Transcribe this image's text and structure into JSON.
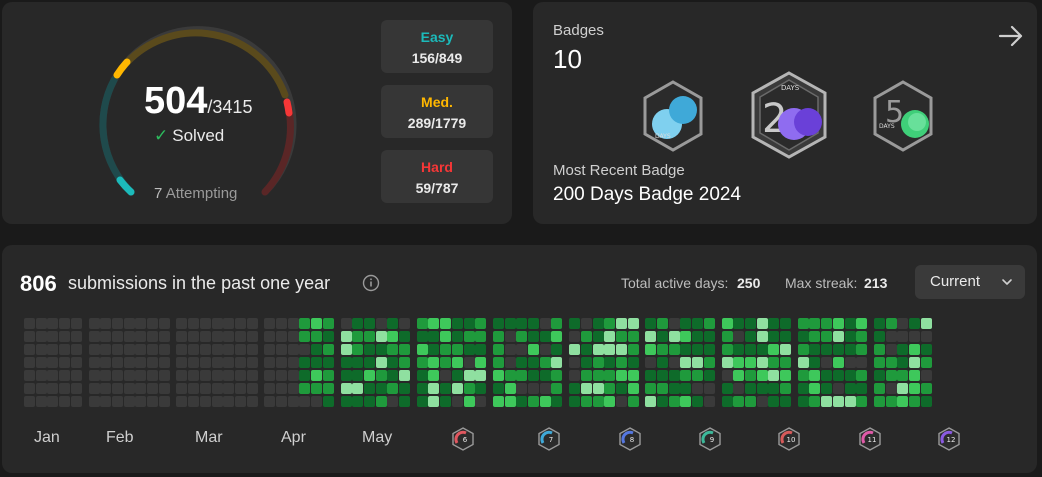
{
  "solved": {
    "count": "504",
    "total": "/3415",
    "label": "Solved",
    "attempting_count": "7",
    "attempting_label": "Attempting",
    "difficulties": [
      {
        "name": "Easy",
        "value": "156/849",
        "color": "#1cbaba"
      },
      {
        "name": "Med.",
        "value": "289/1779",
        "color": "#ffb700"
      },
      {
        "name": "Hard",
        "value": "59/787",
        "color": "#f63737"
      }
    ]
  },
  "badges": {
    "title": "Badges",
    "count": "10",
    "recent_label": "Most Recent Badge",
    "recent_name": "200 Days Badge 2024",
    "items": [
      "50-days-badge-icon",
      "200-days-badge-icon",
      "50-days-badge-icon"
    ]
  },
  "heatmap": {
    "count": "806",
    "text": "submissions in the past one year",
    "total_active_label": "Total active days:",
    "total_active_value": "250",
    "max_streak_label": "Max streak:",
    "max_streak_value": "213",
    "period": "Current",
    "months": [
      "Jan",
      "Feb",
      "Mar",
      "Apr",
      "May"
    ],
    "month_badges": [
      "6",
      "7",
      "8",
      "9",
      "10",
      "11",
      "12"
    ],
    "month_badge_colors": [
      "#e0575f",
      "#3fa9d8",
      "#5577e0",
      "#3cb89a",
      "#d65a5a",
      "#e05aa8",
      "#8a5ae0"
    ],
    "colors": {
      "empty": "#3a3a3a",
      "l1": "#0e6b2a",
      "l2": "#1f9a3c",
      "l3": "#3ec85b",
      "l4": "#8fe0a0"
    }
  }
}
